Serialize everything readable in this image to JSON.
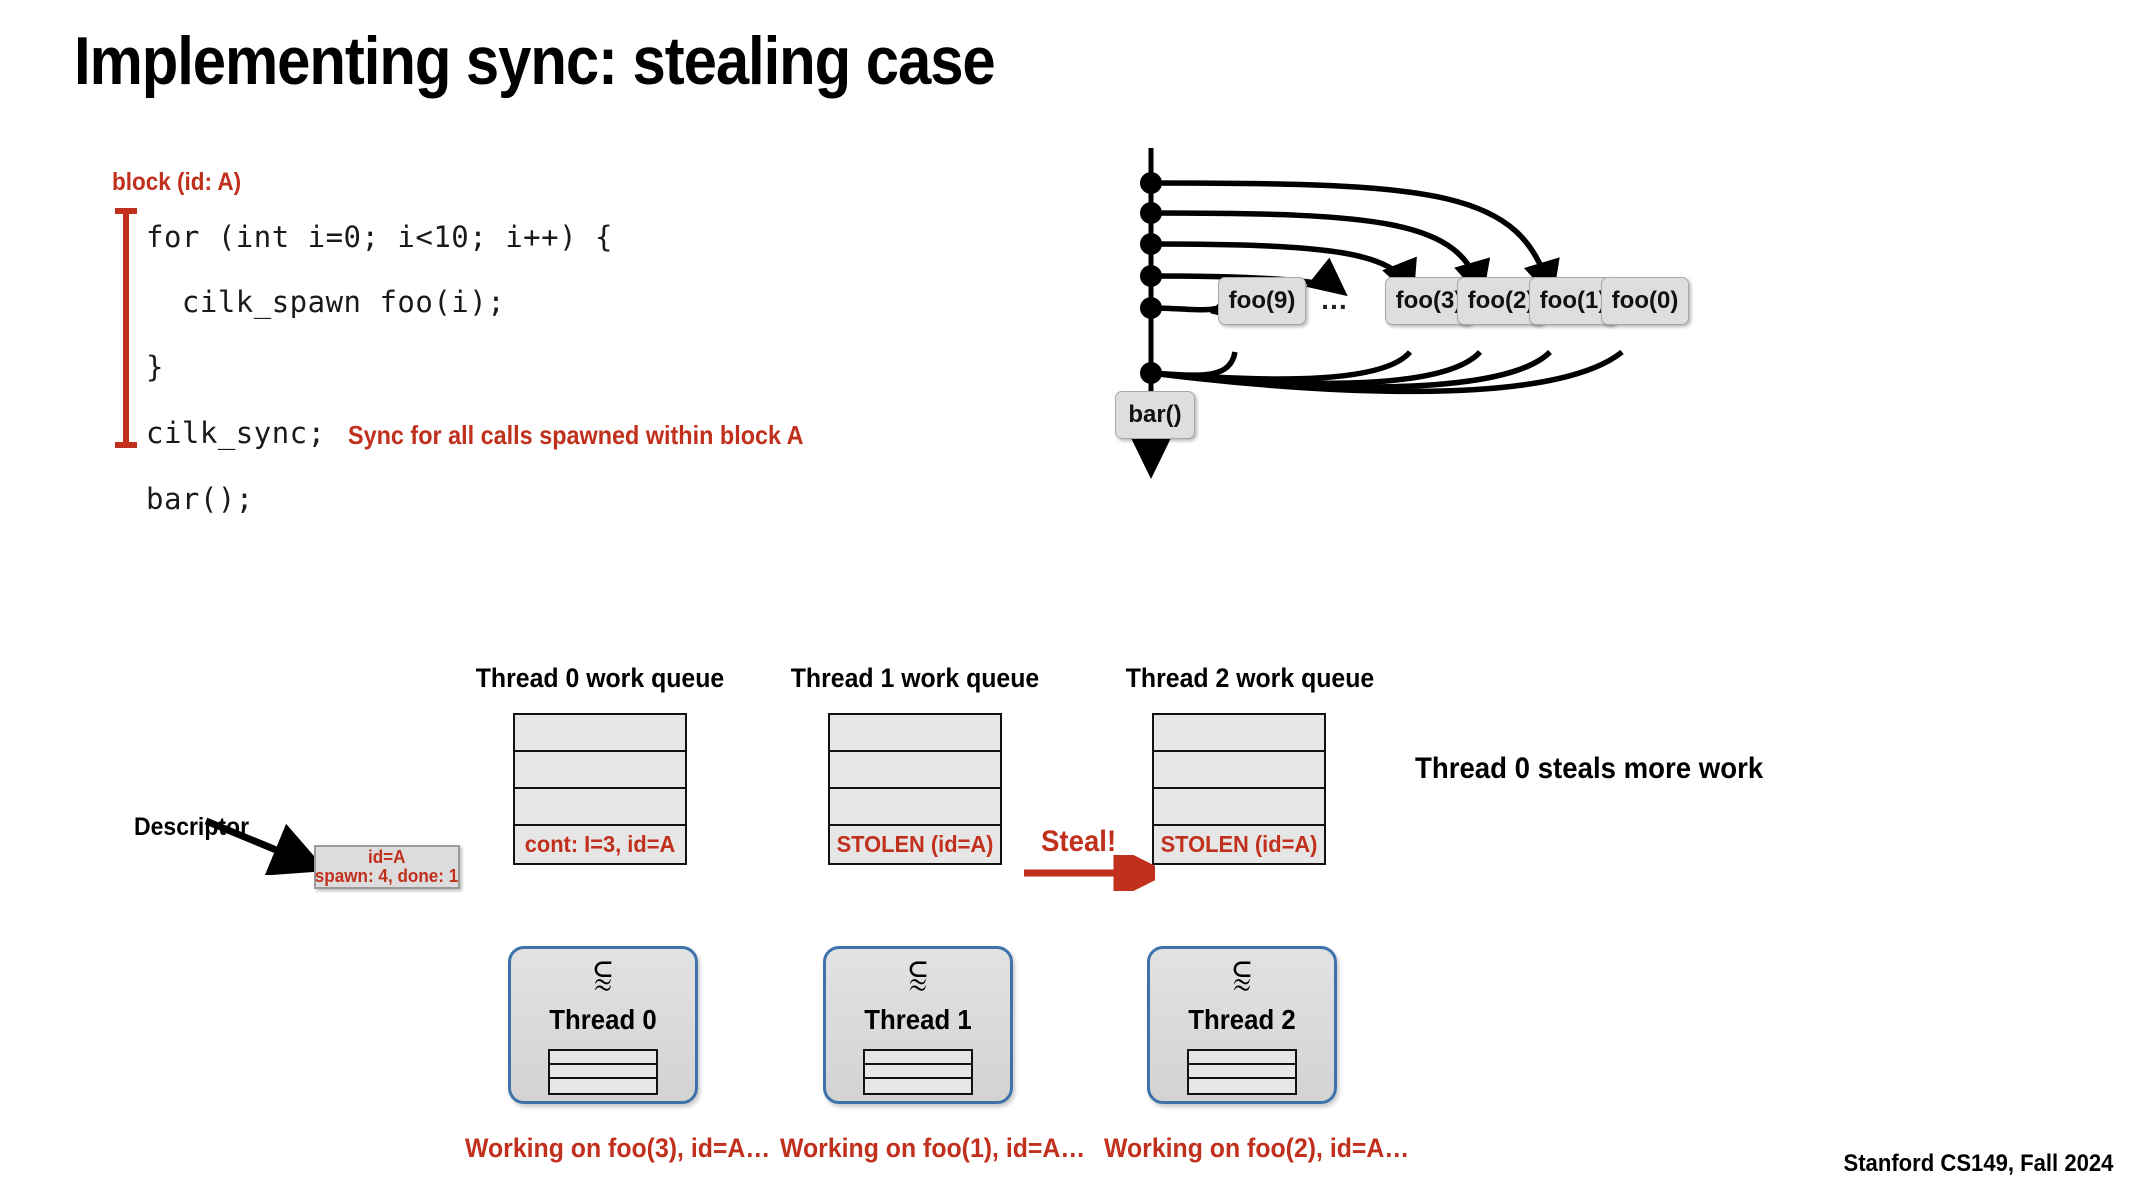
{
  "slide": {
    "title": "Implementing sync: stealing case",
    "footer": "Stanford CS149, Fall 2024"
  },
  "code": {
    "block_label": "block (id: A)",
    "lines": [
      "for (int i=0; i<10; i++) {",
      "  cilk_spawn foo(i);",
      "}",
      "cilk_sync;",
      "bar();"
    ],
    "sync_note": "Sync for all calls spawned within block A"
  },
  "graph": {
    "spawn_boxes": [
      "foo(9)",
      "foo(3)",
      "foo(2)",
      "foo(1)",
      "foo(0)"
    ],
    "ellipsis": "…",
    "continuation_box": "bar()",
    "spawn_point_count": 5
  },
  "queues": [
    {
      "title": "Thread 0 work queue",
      "cells": [
        "",
        "",
        "",
        "cont: I=3, id=A"
      ]
    },
    {
      "title": "Thread 1 work queue",
      "cells": [
        "",
        "",
        "",
        "STOLEN (id=A)"
      ]
    },
    {
      "title": "Thread 2 work queue",
      "cells": [
        "",
        "",
        "",
        "STOLEN (id=A)"
      ]
    }
  ],
  "descriptor": {
    "label": "Descriptor",
    "line1": "id=A",
    "line2": "spawn: 4, done: 1"
  },
  "steal": {
    "label": "Steal!",
    "note": "Thread 0 steals more work"
  },
  "threads": [
    {
      "name": "Thread 0",
      "squiggle": "⫉",
      "caption": "Working on foo(3), id=A…"
    },
    {
      "name": "Thread 1",
      "squiggle": "⫉",
      "caption": "Working on foo(1), id=A…"
    },
    {
      "name": "Thread 2",
      "squiggle": "⫉",
      "caption": "Working on foo(2), id=A…"
    }
  ],
  "colors": {
    "accent_red": "#C0301C",
    "thread_border_blue": "#3E72AB",
    "box_fill": "#DEDEDE"
  }
}
